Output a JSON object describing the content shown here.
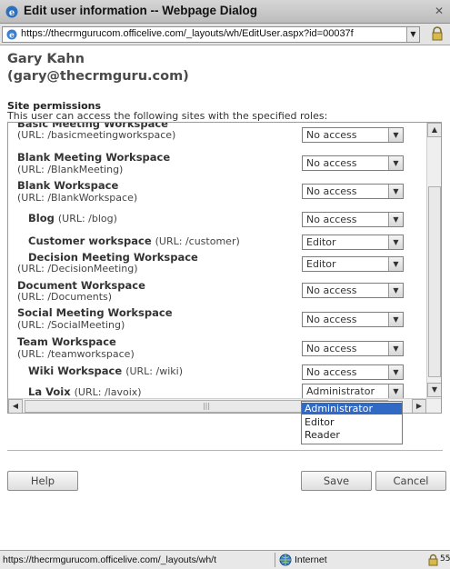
{
  "window": {
    "title": "Edit user information -- Webpage Dialog",
    "close_label": "✕"
  },
  "address": {
    "url": "https://thecrmgurucom.officelive.com/_layouts/wh/EditUser.aspx?id=00037f"
  },
  "user": {
    "name": "Gary Kahn",
    "email": "(gary@thecrmguru.com)"
  },
  "permissions": {
    "title": "Site permissions",
    "description": "This user can access the following sites with the specified roles:",
    "sites": [
      {
        "name": "Basic Meeting Workspace",
        "url": "(URL: /basicmeetingworkspace)",
        "role": "No access"
      },
      {
        "name": "Blank Meeting Workspace",
        "url": "(URL: /BlankMeeting)",
        "role": "No access"
      },
      {
        "name": "Blank Workspace",
        "url": "(URL: /BlankWorkspace)",
        "role": "No access"
      },
      {
        "name": "Blog",
        "url": "(URL: /blog)",
        "role": "No access"
      },
      {
        "name": "Customer workspace",
        "url": "(URL: /customer)",
        "role": "Editor"
      },
      {
        "name": "Decision Meeting Workspace",
        "url": "(URL: /DecisionMeeting)",
        "role": "Editor"
      },
      {
        "name": "Document Workspace",
        "url": "(URL: /Documents)",
        "role": "No access"
      },
      {
        "name": "Social Meeting Workspace",
        "url": "(URL: /SocialMeeting)",
        "role": "No access"
      },
      {
        "name": "Team Workspace",
        "url": "(URL: /teamworkspace)",
        "role": "No access"
      },
      {
        "name": "Wiki Workspace",
        "url": "(URL: /wiki)",
        "role": "No access"
      },
      {
        "name": "La Voix",
        "url": "(URL: /lavoix)",
        "role": "Administrator"
      }
    ],
    "dropdown_options": [
      "Administrator",
      "Editor",
      "Reader"
    ],
    "dropdown_selected": "Administrator"
  },
  "buttons": {
    "help": "Help",
    "save": "Save",
    "cancel": "Cancel"
  },
  "status": {
    "url": "https://thecrmgurucom.officelive.com/_layouts/wh/t",
    "zone": "Internet",
    "zoom": "55"
  },
  "icons": {
    "app": "ie-icon",
    "lock": "lock-icon",
    "globe": "globe-icon"
  }
}
